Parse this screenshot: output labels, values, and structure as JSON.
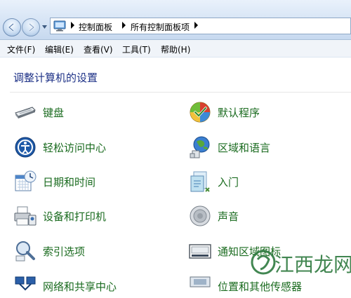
{
  "breadcrumb": [
    "控制面板",
    "所有控制面板项"
  ],
  "menu": [
    "文件(F)",
    "编辑(E)",
    "查看(V)",
    "工具(T)",
    "帮助(H)"
  ],
  "page_title": "调整计算机的设置",
  "items": [
    {
      "label": "键盘",
      "icon": "keyboard-icon"
    },
    {
      "label": "默认程序",
      "icon": "default-programs-icon"
    },
    {
      "label": "轻松访问中心",
      "icon": "ease-of-access-icon"
    },
    {
      "label": "区域和语言",
      "icon": "region-language-icon"
    },
    {
      "label": "日期和时间",
      "icon": "date-time-icon"
    },
    {
      "label": "入门",
      "icon": "getting-started-icon"
    },
    {
      "label": "设备和打印机",
      "icon": "devices-printers-icon"
    },
    {
      "label": "声音",
      "icon": "sound-icon"
    },
    {
      "label": "索引选项",
      "icon": "indexing-options-icon"
    },
    {
      "label": "通知区域图标",
      "icon": "notification-area-icon"
    },
    {
      "label": "网络和共享中心",
      "icon": "network-sharing-icon"
    },
    {
      "label": "位置和其他传感器",
      "icon": "location-sensors-icon"
    }
  ],
  "watermark": "江西龙网"
}
